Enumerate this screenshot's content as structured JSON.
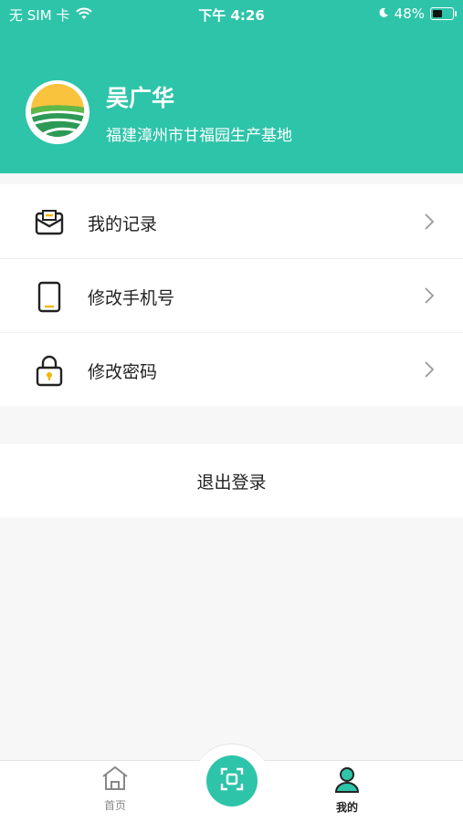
{
  "status_bar": {
    "carrier": "无 SIM 卡",
    "time": "下午 4:26",
    "battery": "48%",
    "battery_level": 0.48,
    "icons": [
      "wifi-icon",
      "moon-icon",
      "battery-icon"
    ]
  },
  "profile": {
    "name": "吴广华",
    "org": "福建漳州市甘福园生产基地",
    "avatar_icon": "farm-logo-icon"
  },
  "menu": {
    "items": [
      {
        "label": "我的记录",
        "icon": "record-envelope-icon"
      },
      {
        "label": "修改手机号",
        "icon": "phone-icon"
      },
      {
        "label": "修改密码",
        "icon": "lock-icon"
      }
    ]
  },
  "logout": {
    "label": "退出登录"
  },
  "tabbar": {
    "home": {
      "label": "首页",
      "icon": "home-icon"
    },
    "scan": {
      "icon": "scan-icon"
    },
    "mine": {
      "label": "我的",
      "icon": "user-icon"
    }
  },
  "colors": {
    "accent": "#2ec4a9",
    "background": "#f7f7f7",
    "icon_yellow": "#f2b705"
  }
}
